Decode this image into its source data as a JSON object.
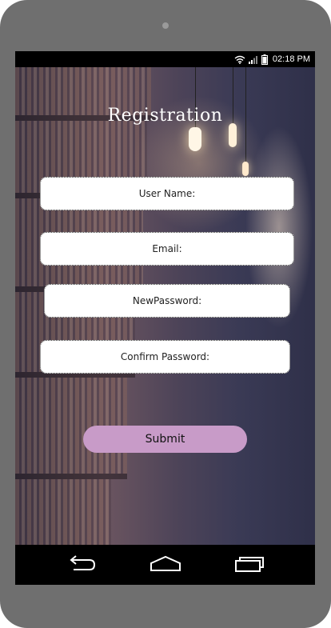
{
  "status_bar": {
    "time": "02:18 PM",
    "icons": [
      "wifi-icon",
      "signal-icon",
      "battery-icon"
    ]
  },
  "page": {
    "title": "Registration"
  },
  "form": {
    "username_placeholder": "User Name:",
    "email_placeholder": "Email:",
    "new_password_placeholder": "NewPassword:",
    "confirm_password_placeholder": "Confirm Password:",
    "submit_label": "Submit"
  },
  "nav_bar": {
    "icons": [
      "back-icon",
      "home-icon",
      "recent-apps-icon"
    ]
  },
  "colors": {
    "device_frame": "#6f6f6f",
    "submit_button": "#c89bc8",
    "field_background": "#ffffff",
    "title_text": "#ffffff"
  }
}
